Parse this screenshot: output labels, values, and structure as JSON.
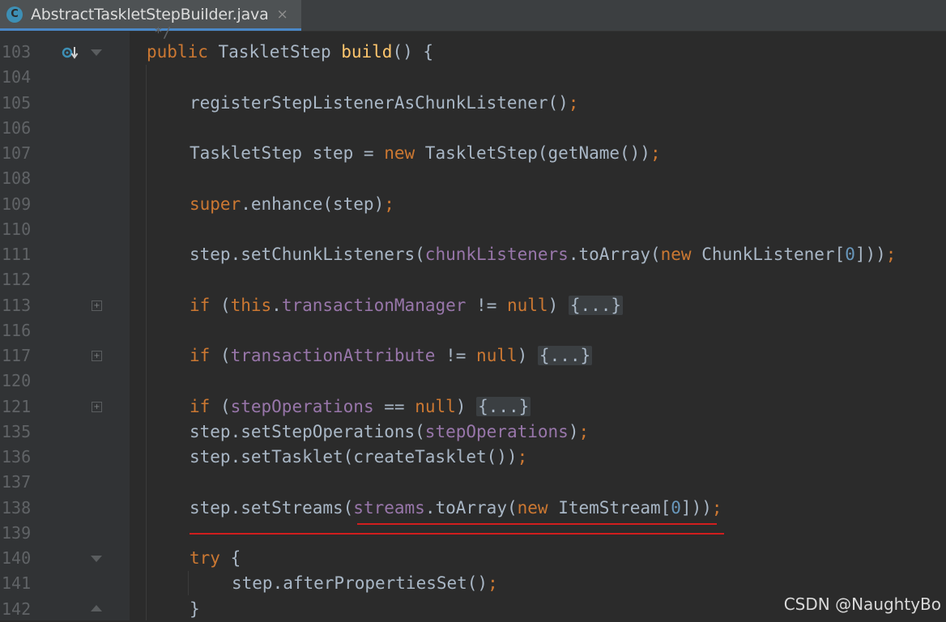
{
  "tab": {
    "title": "AbstractTaskletStepBuilder.java",
    "close": "×",
    "icon_letter": "C"
  },
  "watermark": "CSDN @NaughtyBo",
  "faint_top": "*/",
  "lines": [
    {
      "n": "103",
      "code": "public TaskletStep build() {"
    },
    {
      "n": "104",
      "code": ""
    },
    {
      "n": "105",
      "code": "registerStepListenerAsChunkListener();"
    },
    {
      "n": "106",
      "code": ""
    },
    {
      "n": "107",
      "code": "TaskletStep step = new TaskletStep(getName());"
    },
    {
      "n": "108",
      "code": ""
    },
    {
      "n": "109",
      "code": "super.enhance(step);"
    },
    {
      "n": "110",
      "code": ""
    },
    {
      "n": "111",
      "code": "step.setChunkListeners(chunkListeners.toArray(new ChunkListener[0]));"
    },
    {
      "n": "112",
      "code": ""
    },
    {
      "n": "113",
      "code": "if (this.transactionManager != null) {...}"
    },
    {
      "n": "116",
      "code": ""
    },
    {
      "n": "117",
      "code": "if (transactionAttribute != null) {...}"
    },
    {
      "n": "120",
      "code": ""
    },
    {
      "n": "121",
      "code": "if (stepOperations == null) {...}"
    },
    {
      "n": "135",
      "code": "step.setStepOperations(stepOperations);"
    },
    {
      "n": "136",
      "code": "step.setTasklet(createTasklet());"
    },
    {
      "n": "137",
      "code": ""
    },
    {
      "n": "138",
      "code": "step.setStreams(streams.toArray(new ItemStream[0]));"
    },
    {
      "n": "139",
      "code": ""
    },
    {
      "n": "140",
      "code": "try {"
    },
    {
      "n": "141",
      "code": "step.afterPropertiesSet();"
    },
    {
      "n": "142",
      "code": "}"
    }
  ]
}
